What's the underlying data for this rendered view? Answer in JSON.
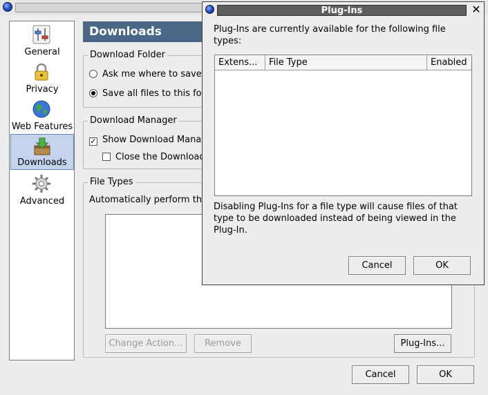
{
  "sidebar": {
    "items": [
      {
        "label": "General",
        "icon": "sliders-icon"
      },
      {
        "label": "Privacy",
        "icon": "padlock-icon"
      },
      {
        "label": "Web Features",
        "icon": "globe-icon"
      },
      {
        "label": "Downloads",
        "icon": "download-box-icon",
        "selected": true
      },
      {
        "label": "Advanced",
        "icon": "gear-icon"
      }
    ]
  },
  "pane": {
    "title": "Downloads",
    "download_folder": {
      "legend": "Download Folder",
      "ask_label": "Ask me where to save",
      "save_label": "Save all files to this fo"
    },
    "download_manager": {
      "legend": "Download Manager",
      "show_label": "Show Download Mana",
      "close_label": "Close the Download"
    },
    "file_types": {
      "legend": "File Types",
      "description": "Automatically perform th",
      "change_action_label": "Change Action...",
      "remove_label": "Remove",
      "plugins_label": "Plug-Ins..."
    }
  },
  "main_buttons": {
    "cancel": "Cancel",
    "ok": "OK"
  },
  "dialog": {
    "title": "Plug-Ins",
    "close_glyph": "✕",
    "intro_line1": "Plug-Ins are currently available for the following file",
    "intro_line2": "types:",
    "columns": [
      "Extens...",
      "File Type",
      "Enabled"
    ],
    "rows": [],
    "note_line1": "Disabling Plug-Ins for a file type will cause files of that",
    "note_line2": "type to be downloaded instead of being viewed in the",
    "note_line3": "Plug-In.",
    "cancel_label": "Cancel",
    "ok_label": "OK"
  },
  "colors": {
    "header_bg": "#4a6785",
    "selection_bg": "#c5d3ee",
    "dialog_title_bg": "#5e5e5e"
  }
}
